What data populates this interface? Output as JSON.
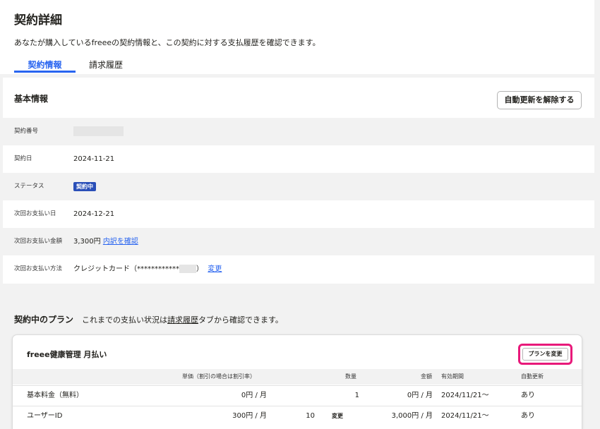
{
  "page": {
    "title": "契約詳細",
    "description": "あなたが購入しているfreeeの契約情報と、この契約に対する支払履歴を確認できます。"
  },
  "tabs": [
    {
      "label": "契約情報",
      "active": true
    },
    {
      "label": "請求履歴",
      "active": false
    }
  ],
  "basic": {
    "title": "基本情報",
    "cancel_button": "自動更新を解除する",
    "rows": [
      {
        "label": "契約番号",
        "value": ""
      },
      {
        "label": "契約日",
        "value": "2024-11-21"
      },
      {
        "label": "ステータス",
        "badge": "契約中"
      },
      {
        "label": "次回お支払い日",
        "value": "2024-12-21"
      },
      {
        "label": "次回お支払い金額",
        "value": "3,300円",
        "link": "内訳を確認"
      },
      {
        "label": "次回お支払い方法",
        "value": "クレジットカード（************",
        "value_suffix": "）",
        "link": "変更"
      }
    ]
  },
  "plan": {
    "title": "契約中のプラン",
    "note_prefix": "これまでの支払い状況は",
    "note_link": "請求履歴",
    "note_suffix": "タブから確認できます。",
    "name": "freee健康管理 月払い",
    "change_button": "プランを変更",
    "columns": {
      "unit_price": "単価（割引の場合は割引率）",
      "quantity": "数量",
      "amount": "金額",
      "period": "有効期間",
      "auto_renew": "自動更新"
    },
    "rows": [
      {
        "name": "基本料金（無料）",
        "unit_price": "0円 / 月",
        "qty": "1",
        "change": "",
        "amount": "0円 / 月",
        "period": "2024/11/21～",
        "auto": "あり"
      },
      {
        "name": "ユーザーID",
        "unit_price": "300円 / 月",
        "qty": "10",
        "change": "変更",
        "amount": "3,000円 / 月",
        "period": "2024/11/21～",
        "auto": "あり"
      }
    ]
  },
  "colors": {
    "accent": "#2864f0",
    "badge": "#2a4fb8",
    "highlight": "#e8197a"
  }
}
